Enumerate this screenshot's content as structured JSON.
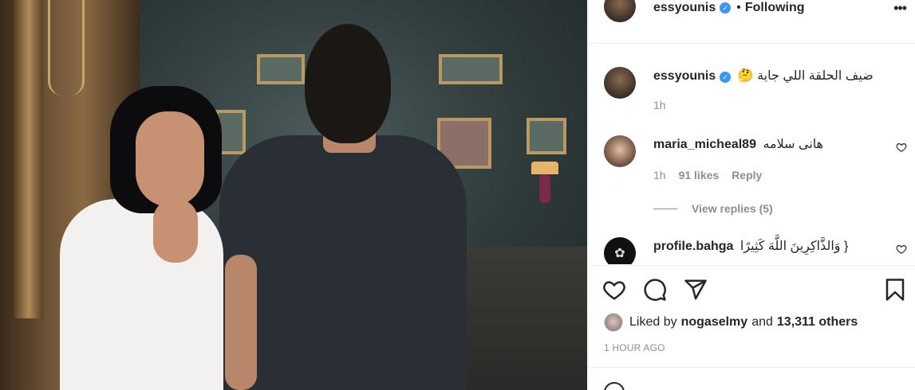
{
  "post": {
    "author": "essyounis",
    "follow_status": "Following",
    "separator": "•",
    "more_glyph": "•••"
  },
  "caption": {
    "username": "essyounis",
    "text": "ضيف الحلقة اللي جاية 🤔",
    "time": "1h"
  },
  "comments": [
    {
      "username": "maria_micheal89",
      "text": "هانى سلامه",
      "time": "1h",
      "likes": "91 likes",
      "reply_label": "Reply",
      "view_replies": "View replies (5)"
    },
    {
      "username": "profile.bahga",
      "text": "{ وَالذَّاكِرِينَ اللَّهَ كَثِيرًا",
      "avatar_glyph": "✿"
    }
  ],
  "likes": {
    "prefix": "Liked by",
    "liker": "nogaselmy",
    "conjunction": "and",
    "others": "13,311 others"
  },
  "timestamp": "1 HOUR AGO",
  "icons": {
    "like": "heart-icon",
    "comment": "comment-icon",
    "share": "paper-plane-icon",
    "save": "bookmark-icon",
    "more": "more-options-icon",
    "verified": "verified-badge-icon",
    "emoji": "emoji-icon"
  },
  "colors": {
    "verified": "#3897f0",
    "text": "#262626",
    "muted": "#8e8e8e",
    "border": "#efefef"
  }
}
